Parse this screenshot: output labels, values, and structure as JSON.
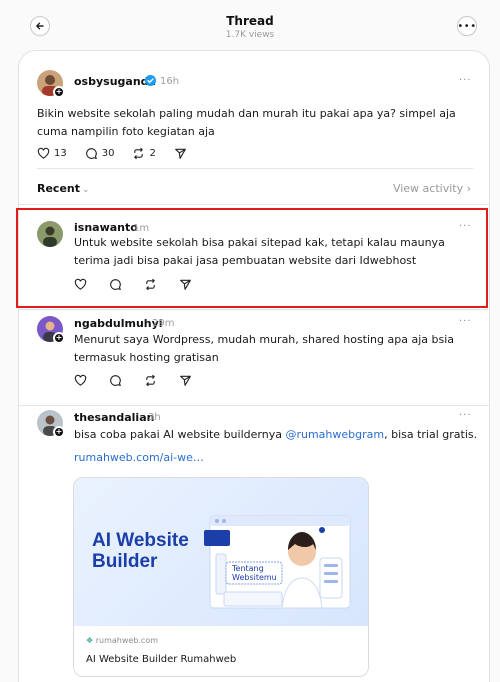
{
  "header": {
    "title": "Thread",
    "views": "1.7K views",
    "back_icon": "arrow-left-icon",
    "more_icon": "more-horizontal-icon"
  },
  "main_post": {
    "username": "osbysuganda",
    "verified": true,
    "time": "16h",
    "text": "Bikin website sekolah paling mudah dan murah itu pakai apa ya? simpel aja cuma nampilin foto kegiatan aja",
    "likes": "13",
    "replies": "30",
    "reposts": "2"
  },
  "sort": {
    "label": "Recent",
    "view_activity": "View activity"
  },
  "replies": [
    {
      "username": "isnawanto",
      "time": "1m",
      "text": "Untuk website sekolah bisa pakai sitepad kak, tetapi kalau maunya terima jadi bisa pakai jasa pembuatan website dari Idwebhost",
      "highlighted": true
    },
    {
      "username": "ngabdulmuhyi",
      "time": "29m",
      "text": "Menurut saya Wordpress, mudah murah, shared hosting apa aja bsia termasuk hosting gratisan"
    },
    {
      "username": "thesandalian",
      "time": "3h",
      "text_before": "bisa coba pakai AI website buildernya ",
      "mention": "@rumahwebgram",
      "text_after": ", bisa trial gratis.",
      "link": "rumahweb.com/ai-we…",
      "preview": {
        "headline_line1": "AI Website",
        "headline_line2": "Builder",
        "overlay_line1": "Tentang",
        "overlay_line2": "Websitemu",
        "domain": "rumahweb.com",
        "title": "AI Website Builder Rumahweb"
      }
    }
  ],
  "colors": {
    "accent_link": "#2b6ecf",
    "highlight_border": "#e21b1b",
    "verified": "#1d9bf0"
  }
}
